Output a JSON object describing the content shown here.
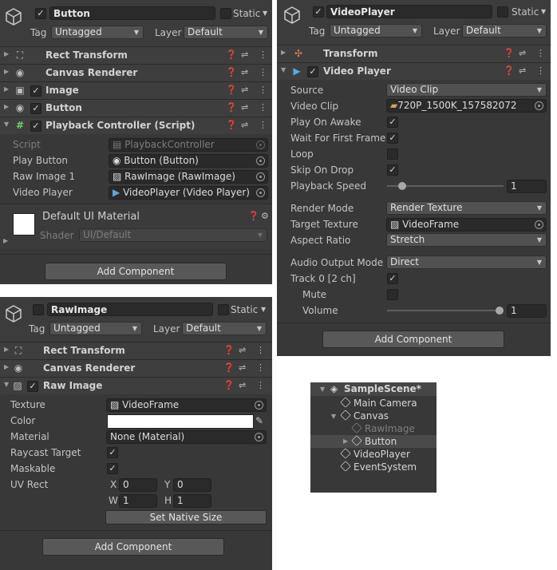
{
  "button_inspector": {
    "object_name": "Button",
    "static_label": "Static",
    "tag_label": "Tag",
    "tag_value": "Untagged",
    "layer_label": "Layer",
    "layer_value": "Default",
    "components": [
      {
        "title": "Rect Transform",
        "icon": "rect-transform-icon"
      },
      {
        "title": "Canvas Renderer",
        "icon": "eye-icon"
      },
      {
        "title": "Image",
        "icon": "image-icon"
      },
      {
        "title": "Button",
        "icon": "button-icon"
      },
      {
        "title": "Playback Controller (Script)",
        "icon": "script-icon"
      }
    ],
    "script_props": [
      {
        "label": "Script",
        "value": "PlaybackController"
      },
      {
        "label": "Play Button",
        "value": "Button (Button)"
      },
      {
        "label": "Raw Image 1",
        "value": "RawImage (RawImage)"
      },
      {
        "label": "Video Player",
        "value": "VideoPlayer (Video Player)"
      }
    ],
    "material_name": "Default UI Material",
    "shader_label": "Shader",
    "shader_value": "UI/Default",
    "add_component": "Add Component"
  },
  "video_inspector": {
    "object_name": "VideoPlayer",
    "static_label": "Static",
    "tag_label": "Tag",
    "tag_value": "Untagged",
    "layer_label": "Layer",
    "layer_value": "Default",
    "components": [
      {
        "title": "Transform",
        "icon": "transform-icon"
      },
      {
        "title": "Video Player",
        "icon": "video-icon"
      }
    ],
    "props": {
      "source_label": "Source",
      "source_value": "Video Clip",
      "clip_label": "Video Clip",
      "clip_value": "720P_1500K_157582072",
      "play_on_awake": "Play On Awake",
      "wait_first": "Wait For First Frame",
      "loop": "Loop",
      "skip_on_drop": "Skip On Drop",
      "speed_label": "Playback Speed",
      "speed_value": "1",
      "render_mode_label": "Render Mode",
      "render_mode_value": "Render Texture",
      "target_texture_label": "Target Texture",
      "target_texture_value": "VideoFrame",
      "aspect_label": "Aspect Ratio",
      "aspect_value": "Stretch",
      "audio_mode_label": "Audio Output Mode",
      "audio_mode_value": "Direct",
      "track_label": "Track 0 [2 ch]",
      "mute_label": "Mute",
      "volume_label": "Volume",
      "volume_value": "1"
    },
    "add_component": "Add Component"
  },
  "rawimage_inspector": {
    "object_name": "RawImage",
    "static_label": "Static",
    "tag_label": "Tag",
    "tag_value": "Untagged",
    "layer_label": "Layer",
    "layer_value": "Default",
    "components": [
      {
        "title": "Rect Transform",
        "icon": "rect-transform-icon"
      },
      {
        "title": "Canvas Renderer",
        "icon": "eye-icon"
      },
      {
        "title": "Raw Image",
        "icon": "image-icon"
      }
    ],
    "props": {
      "texture_label": "Texture",
      "texture_value": "VideoFrame",
      "color_label": "Color",
      "material_label": "Material",
      "material_value": "None (Material)",
      "raycast_label": "Raycast Target",
      "maskable_label": "Maskable",
      "uvrect_label": "UV Rect",
      "x_label": "X",
      "x_value": "0",
      "y_label": "Y",
      "y_value": "0",
      "w_label": "W",
      "w_value": "1",
      "h_label": "H",
      "h_value": "1",
      "native_size": "Set Native Size"
    },
    "add_component": "Add Component"
  },
  "hierarchy": {
    "scene": "SampleScene*",
    "items": [
      "Main Camera",
      "Canvas",
      "RawImage",
      "Button",
      "VideoPlayer",
      "EventSystem"
    ]
  }
}
